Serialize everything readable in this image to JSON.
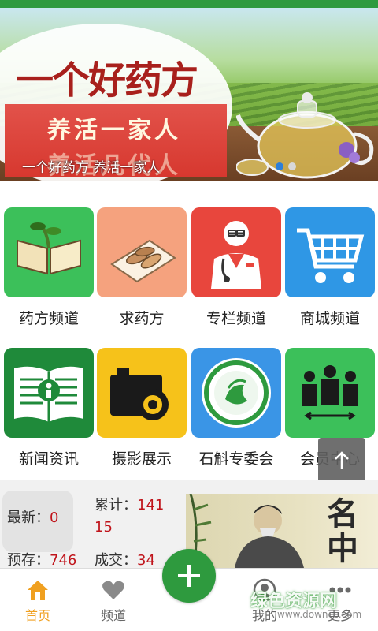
{
  "banner": {
    "title": "一个好药方",
    "slogan_1": "养活一家人",
    "slogan_2": "养活几代人",
    "caption": "一个好药方 养活一家人",
    "slide_count": 2,
    "active_slide": 1
  },
  "grid": [
    {
      "label": "药方频道",
      "icon": "herb-book-icon",
      "color": "#3cc05a"
    },
    {
      "label": "求药方",
      "icon": "herbal-slices-icon",
      "color": "#f5a27e"
    },
    {
      "label": "专栏频道",
      "icon": "doctor-icon",
      "color": "#e8463d"
    },
    {
      "label": "商城频道",
      "icon": "shopping-cart-icon",
      "color": "#2f97e5"
    },
    {
      "label": "新闻资讯",
      "icon": "news-book-icon",
      "color": "#1f8a3a"
    },
    {
      "label": "摄影展示",
      "icon": "camera-icon",
      "color": "#f6c21a"
    },
    {
      "label": "石斛专委会",
      "icon": "committee-badge-icon",
      "color": "#3a95e6"
    },
    {
      "label": "会员中心",
      "icon": "members-icon",
      "color": "#3cc05a"
    }
  ],
  "stats": {
    "latest_label": "最新：",
    "latest_value": "0",
    "total_label": "累计：",
    "total_value_line1": "141",
    "total_value_line2": "15",
    "reserve_label": "预存：",
    "reserve_value": "746",
    "deal_label": "成交：",
    "deal_value": "34",
    "thumb_text": "名中"
  },
  "tabbar": {
    "home": "首页",
    "channel": "频道",
    "mine": "我的",
    "more": "更多"
  },
  "watermark": {
    "title": "绿色资源网",
    "url": "www.downcc.com"
  },
  "colors": {
    "brand_green": "#2e9a3e",
    "value_red": "#c0141b",
    "active_tab": "#f0a020"
  }
}
